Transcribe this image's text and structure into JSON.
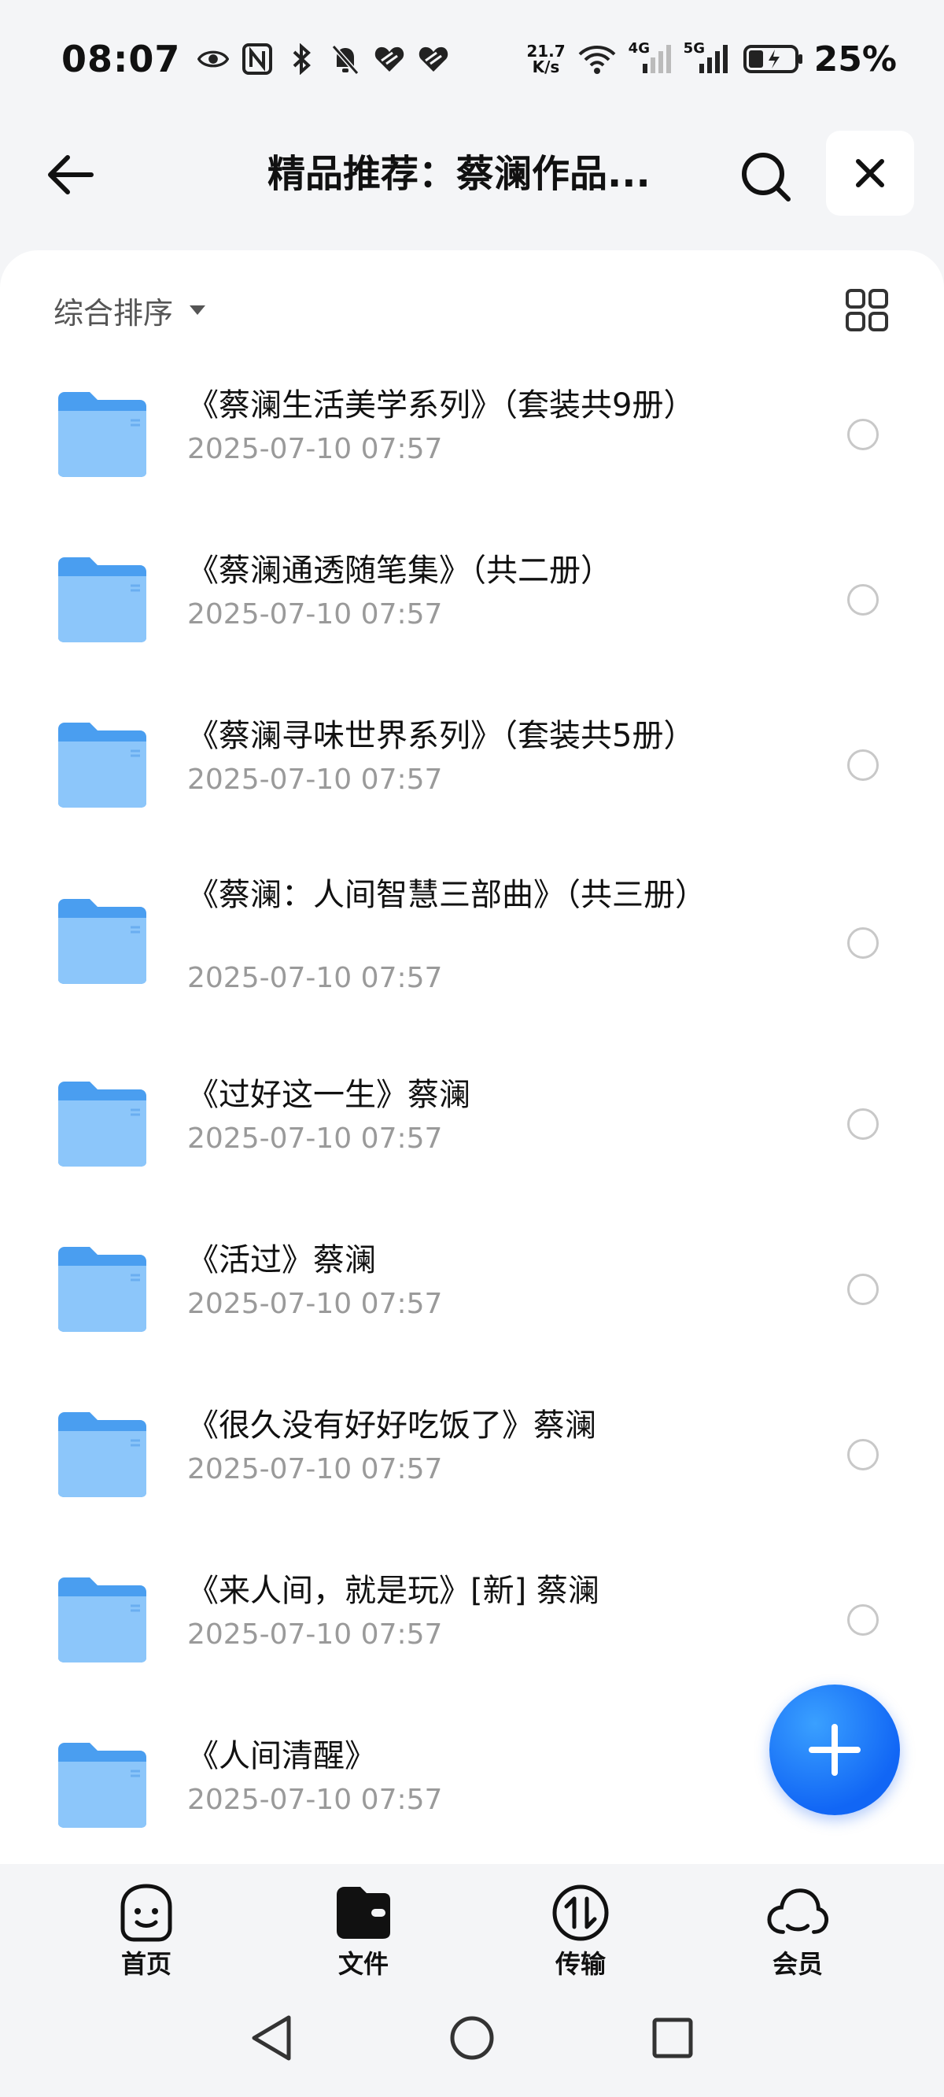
{
  "status_bar": {
    "time": "08:07",
    "net_speed_value": "21.7",
    "net_speed_unit": "K/s",
    "net_4g": "4G",
    "net_5g": "5G",
    "battery": "25%"
  },
  "header": {
    "title": "精品推荐：蔡澜作品..."
  },
  "sort": {
    "label": "综合排序"
  },
  "files": [
    {
      "name": "《蔡澜生活美学系列》（套装共9册）",
      "date": "2025-07-10 07:57"
    },
    {
      "name": "《蔡澜通透随笔集》（共二册）",
      "date": "2025-07-10 07:57"
    },
    {
      "name": "《蔡澜寻味世界系列》（套装共5册）",
      "date": "2025-07-10 07:57"
    },
    {
      "name": "《蔡澜：人间智慧三部曲》（共三册）",
      "date": "2025-07-10 07:57"
    },
    {
      "name": "《过好这一生》蔡澜",
      "date": "2025-07-10 07:57"
    },
    {
      "name": "《活过》蔡澜",
      "date": "2025-07-10 07:57"
    },
    {
      "name": "《很久没有好好吃饭了》蔡澜",
      "date": "2025-07-10 07:57"
    },
    {
      "name": "《来人间，就是玩》[新] 蔡澜",
      "date": "2025-07-10 07:57"
    },
    {
      "name": "《人间清醒》",
      "date": "2025-07-10 07:57"
    }
  ],
  "bottom_nav": [
    {
      "label": "首页",
      "icon": "smiley-icon"
    },
    {
      "label": "文件",
      "icon": "folder-wallet-icon"
    },
    {
      "label": "传输",
      "icon": "transfer-icon"
    },
    {
      "label": "会员",
      "icon": "cloud-icon"
    }
  ],
  "colors": {
    "accent": "#1166f5",
    "folder": "#62b0f5"
  }
}
